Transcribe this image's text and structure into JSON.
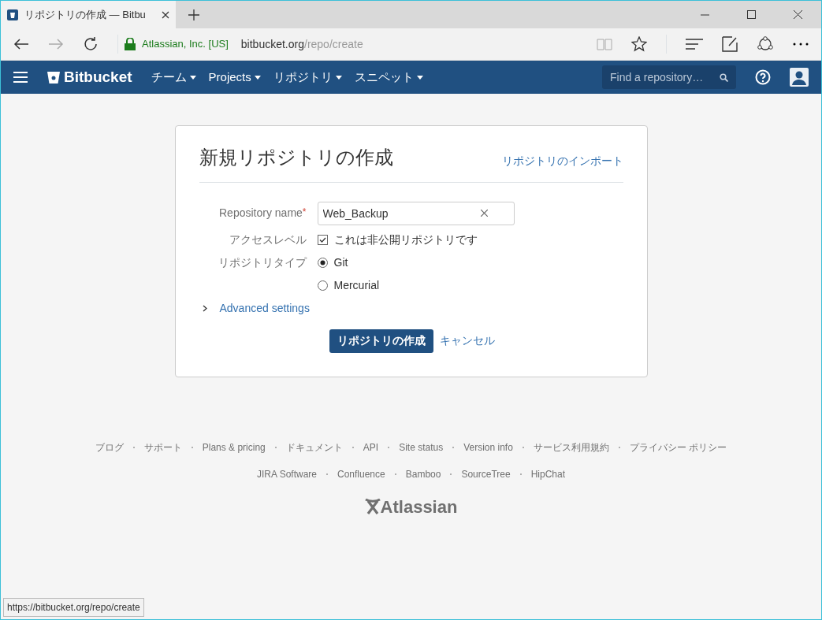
{
  "browser": {
    "tab": {
      "title": "リポジトリの作成 — Bitbu"
    },
    "address": {
      "site_identity": "Atlassian, Inc. [US]",
      "host": "bitbucket.org",
      "path": "/repo/create"
    }
  },
  "navbar": {
    "brand": "Bitbucket",
    "menus": [
      {
        "label": "チーム"
      },
      {
        "label": "Projects"
      },
      {
        "label": "リポジトリ"
      },
      {
        "label": "スニペット"
      }
    ],
    "search": {
      "placeholder": "Find a repository…"
    }
  },
  "form": {
    "title": "新規リポジトリの作成",
    "import_link": "リポジトリのインポート",
    "repository_name": {
      "label": "Repository name",
      "required_marker": "*",
      "value": "Web_Backup"
    },
    "access_level": {
      "label": "アクセスレベル",
      "checkbox": "これは非公開リポジトリです",
      "checked": true
    },
    "repository_type": {
      "label": "リポジトリタイプ",
      "options": [
        {
          "label": "Git",
          "selected": true
        },
        {
          "label": "Mercurial",
          "selected": false
        }
      ]
    },
    "advanced": {
      "label": "Advanced settings",
      "expanded": false
    },
    "submit": "リポジトリの作成",
    "cancel": "キャンセル"
  },
  "footer": {
    "links": [
      "ブログ",
      "サポート",
      "Plans & pricing",
      "ドキュメント",
      "API",
      "Site status",
      "Version info",
      "サービス利用規約",
      "プライバシー ポリシー"
    ],
    "products": [
      "JIRA Software",
      "Confluence",
      "Bamboo",
      "SourceTree",
      "HipChat"
    ],
    "logo": "Atlassian"
  },
  "status_bar": "https://bitbucket.org/repo/create"
}
